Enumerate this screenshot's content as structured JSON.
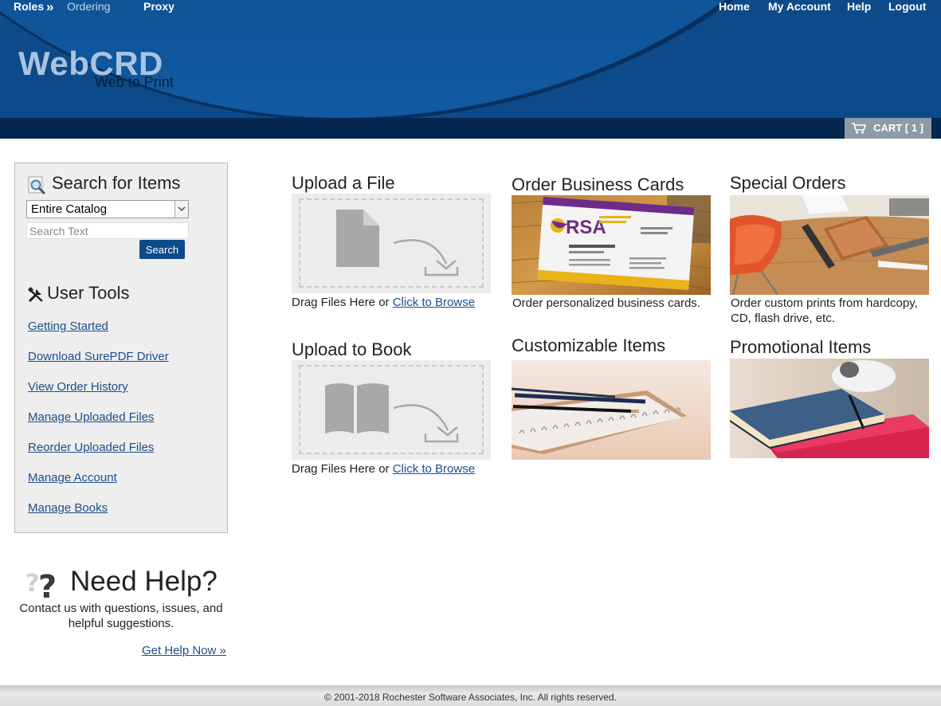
{
  "topnav": {
    "roles": "Roles",
    "ordering": "Ordering",
    "proxy": "Proxy",
    "home": "Home",
    "my_account": "My Account",
    "help": "Help",
    "logout": "Logout"
  },
  "brand": {
    "title": "WebCRD",
    "subtitle": "Web to Print"
  },
  "cart": {
    "label": "CART [ 1 ]"
  },
  "search": {
    "heading": "Search for Items",
    "catalog": "Entire Catalog",
    "placeholder": "Search Text",
    "button": "Search"
  },
  "tools": {
    "heading": "User Tools",
    "links": [
      "Getting Started",
      "Download SurePDF Driver",
      "View Order History",
      "Manage Uploaded Files",
      "Reorder Uploaded Files",
      "Manage Account",
      "Manage Books"
    ]
  },
  "help": {
    "title": "Need Help?",
    "text": "Contact us with questions, issues, and helpful suggestions.",
    "link": "Get Help Now »"
  },
  "tiles": {
    "upload_file": {
      "title": "Upload a File",
      "caption_prefix": "Drag Files Here or ",
      "caption_link": "Click to Browse"
    },
    "upload_book": {
      "title": "Upload to Book",
      "caption_prefix": "Drag Files Here or ",
      "caption_link": "Click to Browse"
    },
    "business_cards": {
      "title": "Order Business Cards",
      "caption": "Order personalized business cards.",
      "card_logo": "RSA"
    },
    "special_orders": {
      "title": "Special Orders",
      "caption": "Order custom prints from hardcopy, CD, flash drive, etc."
    },
    "customizable": {
      "title": "Customizable Items"
    },
    "promotional": {
      "title": "Promotional Items"
    }
  },
  "footer": {
    "copyright": "© 2001-2018 Rochester Software Associates, Inc. All rights reserved."
  },
  "colors": {
    "header": "#0d4a8a",
    "header_band": "#06274f",
    "link": "#1a4f8a",
    "button": "#0d4a8a",
    "cart": "#8f9aa6"
  }
}
